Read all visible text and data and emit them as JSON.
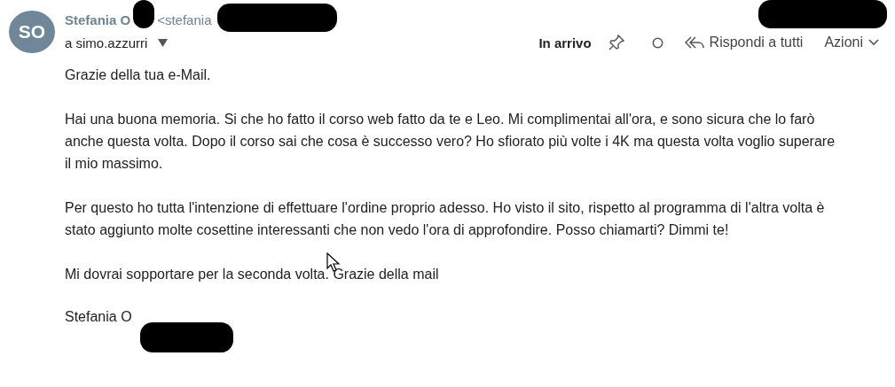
{
  "sender": {
    "initials": "SO",
    "name": "Stefania O",
    "address": "<stefania",
    "recipient": "a simo.azzurri"
  },
  "toolbar": {
    "folder": "In arrivo",
    "reply_all": "Rispondi a tutti",
    "actions": "Azioni"
  },
  "body": [
    "Grazie della tua e-Mail.",
    "Hai una buona memoria. Si che ho fatto il corso web fatto da te e Leo. Mi complimentai all'ora, e sono sicura che lo farò anche questa volta. Dopo il corso sai che cosa è successo vero? Ho sfiorato più volte i 4K ma questa volta voglio superare il mio massimo.",
    "Per questo ho tutta l'intenzione di effettuare l'ordine proprio adesso. Ho visto il sito, rispetto al programma di l'altra volta è stato aggiunto molte cosettine interessanti che non vedo l'ora di approfondire. Posso chiamarti? Dimmi te!",
    "Mi dovrai sopportare per la seconda volta. Grazie della mail"
  ],
  "signature": "Stefania O"
}
